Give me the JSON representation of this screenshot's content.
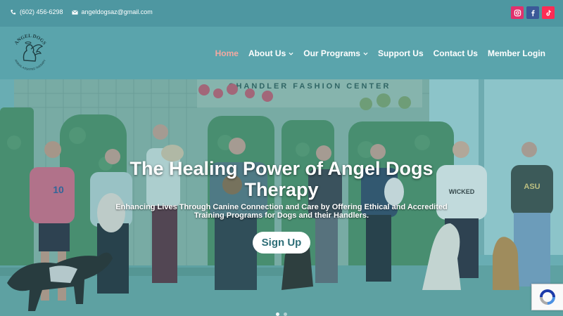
{
  "topbar": {
    "phone": "(602) 456-6298",
    "email": "angeldogsaz@gmail.com",
    "social": [
      {
        "icon": "instagram-icon",
        "color": "#e1306c"
      },
      {
        "icon": "facebook-icon",
        "color": "#3b5998"
      },
      {
        "icon": "tiktok-icon",
        "color": "#fe2c55"
      }
    ]
  },
  "header": {
    "logo_text": "ANGEL DOGS",
    "logo_subtext": "ANIMAL ASSISTED THERAPY",
    "nav": [
      {
        "label": "Home",
        "active": true
      },
      {
        "label": "About Us",
        "dropdown": true
      },
      {
        "label": "Our Programs",
        "dropdown": true
      },
      {
        "label": "Support Us"
      },
      {
        "label": "Contact Us"
      },
      {
        "label": "Member Login"
      }
    ]
  },
  "hero": {
    "background_sign": "CHANDLER FASHION CENTER",
    "title_line1": "The Healing Power of Angel Dogs",
    "title_line2": "Therapy",
    "subtitle_line1": "Enhancing Lives Through Canine Connection and Care by Offering Ethical and Accredited",
    "subtitle_line2": "Training Programs for Dogs and their Handlers.",
    "cta_label": "Sign Up",
    "slide_count": 2,
    "shirt_texts": [
      "10",
      "WICKED",
      "ASU"
    ]
  },
  "colors": {
    "topbar": "#4e97a1",
    "header": "#5aa4ac",
    "nav_active": "#f4a9a1",
    "cta_text": "#2e6e77"
  }
}
